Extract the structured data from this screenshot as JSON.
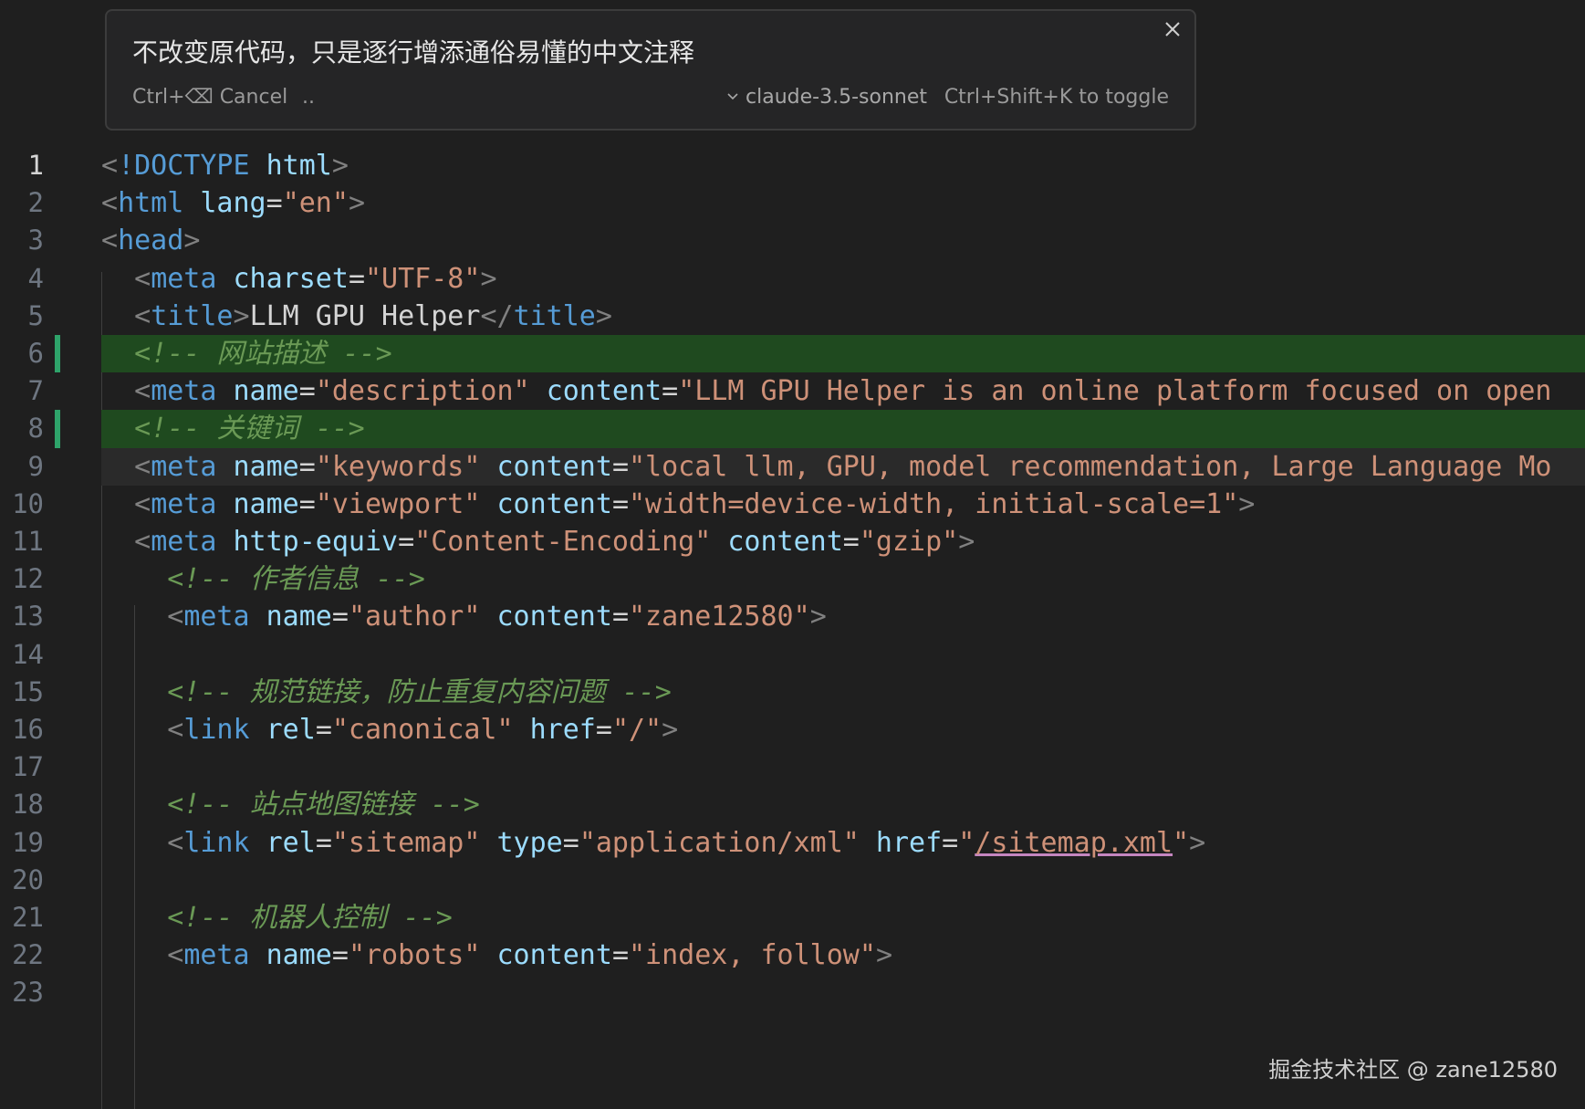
{
  "prompt": {
    "text": "不改变原代码，只是逐行增添通俗易懂的中文注释",
    "cancel_shortcut": "Ctrl+⌫",
    "cancel_label": "Cancel",
    "ellipsis": "..",
    "model": "claude-3.5-sonnet",
    "toggle_hint": "Ctrl+Shift+K to toggle",
    "close_icon": "close-icon",
    "model_icon": "chevron-down-icon"
  },
  "editor": {
    "lines": [
      {
        "n": "1",
        "tokens": [
          [
            "b",
            "<"
          ],
          [
            "t",
            "!DOCTYPE"
          ],
          [
            "x",
            " "
          ],
          [
            "a",
            "html"
          ],
          [
            "b",
            ">"
          ]
        ]
      },
      {
        "n": "2",
        "tokens": [
          [
            "b",
            "<"
          ],
          [
            "t",
            "html"
          ],
          [
            "x",
            " "
          ],
          [
            "a",
            "lang"
          ],
          [
            "e",
            "="
          ],
          [
            "s",
            "\"en\""
          ],
          [
            "b",
            ">"
          ]
        ]
      },
      {
        "n": "3",
        "tokens": [
          [
            "b",
            "<"
          ],
          [
            "t",
            "head"
          ],
          [
            "b",
            ">"
          ]
        ]
      },
      {
        "n": "4",
        "tokens": [
          [
            "x",
            "  "
          ],
          [
            "b",
            "<"
          ],
          [
            "t",
            "meta"
          ],
          [
            "x",
            " "
          ],
          [
            "a",
            "charset"
          ],
          [
            "e",
            "="
          ],
          [
            "s",
            "\"UTF-8\""
          ],
          [
            "b",
            ">"
          ]
        ]
      },
      {
        "n": "5",
        "tokens": [
          [
            "x",
            "  "
          ],
          [
            "b",
            "<"
          ],
          [
            "t",
            "title"
          ],
          [
            "b",
            ">"
          ],
          [
            "x",
            "LLM GPU Helper"
          ],
          [
            "b",
            "</"
          ],
          [
            "t",
            "title"
          ],
          [
            "b",
            ">"
          ]
        ]
      },
      {
        "n": "6",
        "tokens": [
          [
            "x",
            "  "
          ],
          [
            "c",
            "<!-- 网站描述 -->"
          ]
        ]
      },
      {
        "n": "7",
        "tokens": [
          [
            "x",
            "  "
          ],
          [
            "b",
            "<"
          ],
          [
            "t",
            "meta"
          ],
          [
            "x",
            " "
          ],
          [
            "a",
            "name"
          ],
          [
            "e",
            "="
          ],
          [
            "s",
            "\"description\""
          ],
          [
            "x",
            " "
          ],
          [
            "a",
            "content"
          ],
          [
            "e",
            "="
          ],
          [
            "s",
            "\"LLM GPU Helper is an online platform focused on open"
          ]
        ]
      },
      {
        "n": "8",
        "tokens": [
          [
            "x",
            "  "
          ],
          [
            "c",
            "<!-- 关键词 -->"
          ]
        ]
      },
      {
        "n": "9",
        "tokens": [
          [
            "x",
            "  "
          ],
          [
            "b",
            "<"
          ],
          [
            "t",
            "meta"
          ],
          [
            "x",
            " "
          ],
          [
            "a",
            "name"
          ],
          [
            "e",
            "="
          ],
          [
            "s",
            "\"keywords\""
          ],
          [
            "x",
            " "
          ],
          [
            "a",
            "content"
          ],
          [
            "e",
            "="
          ],
          [
            "s",
            "\"local llm, GPU, model recommendation, Large Language Mo"
          ]
        ]
      },
      {
        "n": "10",
        "tokens": [
          [
            "x",
            "  "
          ],
          [
            "b",
            "<"
          ],
          [
            "t",
            "meta"
          ],
          [
            "x",
            " "
          ],
          [
            "a",
            "name"
          ],
          [
            "e",
            "="
          ],
          [
            "s",
            "\"viewport\""
          ],
          [
            "x",
            " "
          ],
          [
            "a",
            "content"
          ],
          [
            "e",
            "="
          ],
          [
            "s",
            "\"width=device-width, initial-scale=1\""
          ],
          [
            "b",
            ">"
          ]
        ]
      },
      {
        "n": "11",
        "tokens": [
          [
            "x",
            "  "
          ],
          [
            "b",
            "<"
          ],
          [
            "t",
            "meta"
          ],
          [
            "x",
            " "
          ],
          [
            "a",
            "http-equiv"
          ],
          [
            "e",
            "="
          ],
          [
            "s",
            "\"Content-Encoding\""
          ],
          [
            "x",
            " "
          ],
          [
            "a",
            "content"
          ],
          [
            "e",
            "="
          ],
          [
            "s",
            "\"gzip\""
          ],
          [
            "b",
            ">"
          ]
        ]
      },
      {
        "n": "12",
        "tokens": [
          [
            "x",
            "    "
          ],
          [
            "c",
            "<!-- 作者信息 -->"
          ]
        ]
      },
      {
        "n": "13",
        "tokens": [
          [
            "x",
            "    "
          ],
          [
            "b",
            "<"
          ],
          [
            "t",
            "meta"
          ],
          [
            "x",
            " "
          ],
          [
            "a",
            "name"
          ],
          [
            "e",
            "="
          ],
          [
            "s",
            "\"author\""
          ],
          [
            "x",
            " "
          ],
          [
            "a",
            "content"
          ],
          [
            "e",
            "="
          ],
          [
            "s",
            "\"zane12580\""
          ],
          [
            "b",
            ">"
          ]
        ]
      },
      {
        "n": "14",
        "tokens": []
      },
      {
        "n": "15",
        "tokens": [
          [
            "x",
            "    "
          ],
          [
            "c",
            "<!-- 规范链接，防止重复内容问题 -->"
          ]
        ]
      },
      {
        "n": "16",
        "tokens": [
          [
            "x",
            "    "
          ],
          [
            "b",
            "<"
          ],
          [
            "t",
            "link"
          ],
          [
            "x",
            " "
          ],
          [
            "a",
            "rel"
          ],
          [
            "e",
            "="
          ],
          [
            "s",
            "\"canonical\""
          ],
          [
            "x",
            " "
          ],
          [
            "a",
            "href"
          ],
          [
            "e",
            "="
          ],
          [
            "s",
            "\"/\""
          ],
          [
            "b",
            ">"
          ]
        ]
      },
      {
        "n": "17",
        "tokens": []
      },
      {
        "n": "18",
        "tokens": [
          [
            "x",
            "    "
          ],
          [
            "c",
            "<!-- 站点地图链接 -->"
          ]
        ]
      },
      {
        "n": "19",
        "tokens": [
          [
            "x",
            "    "
          ],
          [
            "b",
            "<"
          ],
          [
            "t",
            "link"
          ],
          [
            "x",
            " "
          ],
          [
            "a",
            "rel"
          ],
          [
            "e",
            "="
          ],
          [
            "s",
            "\"sitemap\""
          ],
          [
            "x",
            " "
          ],
          [
            "a",
            "type"
          ],
          [
            "e",
            "="
          ],
          [
            "s",
            "\"application/xml\""
          ],
          [
            "x",
            " "
          ],
          [
            "a",
            "href"
          ],
          [
            "e",
            "="
          ],
          [
            "s",
            "\""
          ],
          [
            "l",
            "/sitemap.xml"
          ],
          [
            "s",
            "\""
          ],
          [
            "b",
            ">"
          ]
        ]
      },
      {
        "n": "20",
        "tokens": []
      },
      {
        "n": "21",
        "tokens": [
          [
            "x",
            "    "
          ],
          [
            "c",
            "<!-- 机器人控制 -->"
          ]
        ]
      },
      {
        "n": "22",
        "tokens": [
          [
            "x",
            "    "
          ],
          [
            "b",
            "<"
          ],
          [
            "t",
            "meta"
          ],
          [
            "x",
            " "
          ],
          [
            "a",
            "name"
          ],
          [
            "e",
            "="
          ],
          [
            "s",
            "\"robots\""
          ],
          [
            "x",
            " "
          ],
          [
            "a",
            "content"
          ],
          [
            "e",
            "="
          ],
          [
            "s",
            "\"index, follow\""
          ],
          [
            "b",
            ">"
          ]
        ]
      },
      {
        "n": "23",
        "tokens": []
      }
    ],
    "added_lines": [
      6,
      8
    ],
    "current_line": 9,
    "active_line": 1
  },
  "watermark": "掘金技术社区 @ zane12580",
  "colors": {
    "background": "#1f1f1f",
    "added_line": "#1f4a1f",
    "gutter_added": "#2ea36a",
    "tag": "#569cd6",
    "attribute": "#9cdcfe",
    "string": "#ce9178",
    "comment": "#6a9955"
  }
}
